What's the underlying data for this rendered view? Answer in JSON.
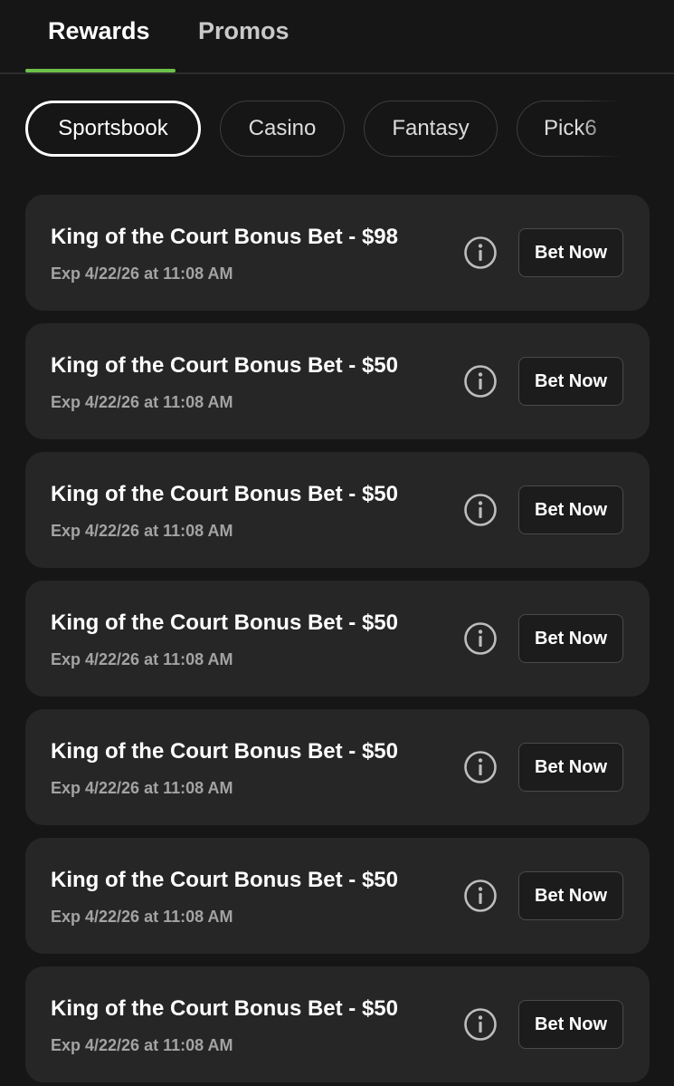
{
  "tabs": [
    {
      "label": "Rewards",
      "active": true
    },
    {
      "label": "Promos",
      "active": false
    }
  ],
  "accent_color": "#6cc04a",
  "categories": [
    {
      "label": "Sportsbook",
      "active": true
    },
    {
      "label": "Casino",
      "active": false
    },
    {
      "label": "Fantasy",
      "active": false
    },
    {
      "label": "Pick6",
      "active": false
    }
  ],
  "rewards": [
    {
      "title": "King of the Court Bonus Bet - $98",
      "expiry": "Exp 4/22/26 at 11:08 AM",
      "button": "Bet Now",
      "icon": "info-icon"
    },
    {
      "title": "King of the Court Bonus Bet - $50",
      "expiry": "Exp 4/22/26 at 11:08 AM",
      "button": "Bet Now",
      "icon": "info-icon"
    },
    {
      "title": "King of the Court Bonus Bet - $50",
      "expiry": "Exp 4/22/26 at 11:08 AM",
      "button": "Bet Now",
      "icon": "info-icon"
    },
    {
      "title": "King of the Court Bonus Bet - $50",
      "expiry": "Exp 4/22/26 at 11:08 AM",
      "button": "Bet Now",
      "icon": "info-icon"
    },
    {
      "title": "King of the Court Bonus Bet - $50",
      "expiry": "Exp 4/22/26 at 11:08 AM",
      "button": "Bet Now",
      "icon": "info-icon"
    },
    {
      "title": "King of the Court Bonus Bet - $50",
      "expiry": "Exp 4/22/26 at 11:08 AM",
      "button": "Bet Now",
      "icon": "info-icon"
    },
    {
      "title": "King of the Court Bonus Bet - $50",
      "expiry": "Exp 4/22/26 at 11:08 AM",
      "button": "Bet Now",
      "icon": "info-icon"
    }
  ]
}
